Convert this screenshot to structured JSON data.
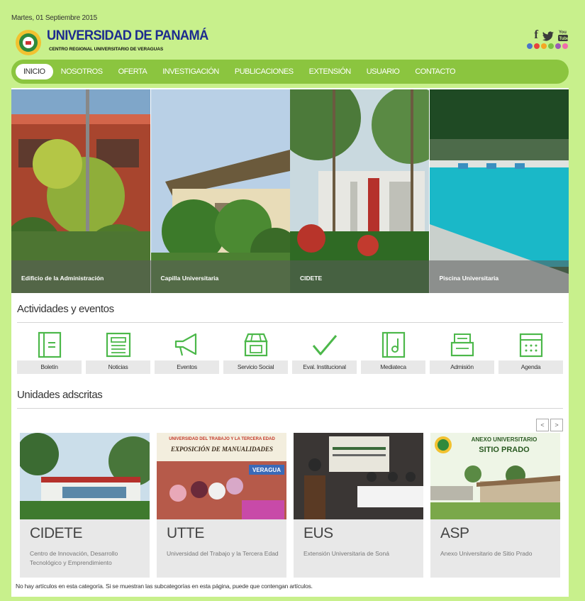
{
  "header": {
    "date": "Martes, 01 Septiembre 2015",
    "university": "UNIVERSIDAD DE PANAMÁ",
    "subtitle": "CENTRO REGIONAL UNIVERSITARIO DE VERAGUAS",
    "social": [
      {
        "icon": "facebook-icon",
        "glyph": "f"
      },
      {
        "icon": "twitter-icon",
        "glyph": "🐦"
      },
      {
        "icon": "youtube-icon",
        "glyph": "You"
      }
    ],
    "dot_colors": [
      "#4a74c9",
      "#e8433b",
      "#f5a623",
      "#7ac143",
      "#9b59b6",
      "#f06eaa"
    ]
  },
  "nav": {
    "items": [
      "INICIO",
      "NOSOTROS",
      "OFERTA",
      "INVESTIGACIÓN",
      "PUBLICACIONES",
      "EXTENSIÓN",
      "USUARIO",
      "CONTACTO"
    ]
  },
  "banner": {
    "panels": [
      "Edificio de la Administración",
      "Capilla Universitaria",
      "CIDETE",
      "Piscina Universitaria"
    ]
  },
  "activities": {
    "title": "Actividades y eventos",
    "items": [
      {
        "label": "Boletín",
        "icon": "bulletin-icon"
      },
      {
        "label": "Noticias",
        "icon": "news-icon"
      },
      {
        "label": "Eventos",
        "icon": "megaphone-icon"
      },
      {
        "label": "Servicio Social",
        "icon": "shop-icon"
      },
      {
        "label": "Eval. Institucional",
        "icon": "check-icon"
      },
      {
        "label": "Mediateca",
        "icon": "music-icon"
      },
      {
        "label": "Admisión",
        "icon": "inbox-icon"
      },
      {
        "label": "Agenda",
        "icon": "calendar-icon"
      }
    ]
  },
  "units": {
    "title": "Unidades adscritas",
    "prev": "<",
    "next": ">",
    "items": [
      {
        "abbr": "CIDETE",
        "desc": "Centro de Innovación, Desarrollo Tecnológico y Emprendimiento"
      },
      {
        "abbr": "UTTE",
        "desc": "Universidad del Trabajo y la Tercera Edad"
      },
      {
        "abbr": "EUS",
        "desc": "Extensión Universitaria de Soná"
      },
      {
        "abbr": "ASP",
        "desc": "Anexo Universitario de Sitio Prado"
      }
    ],
    "photo_text": {
      "utte_banner_1": "UNIVERSIDAD DEL TRABAJO Y LA TERCERA EDAD",
      "utte_banner_2": "EXPOSICIÓN DE MANUALIDADES",
      "utte_sign": "VERAGUA",
      "asp_title_1": "ANEXO UNIVERSITARIO",
      "asp_title_2": "SITIO PRADO"
    }
  },
  "footer": {
    "note": "No hay artículos en esta categoría. Si se muestran las subcategorías en esta página, puede que contengan artículos."
  }
}
